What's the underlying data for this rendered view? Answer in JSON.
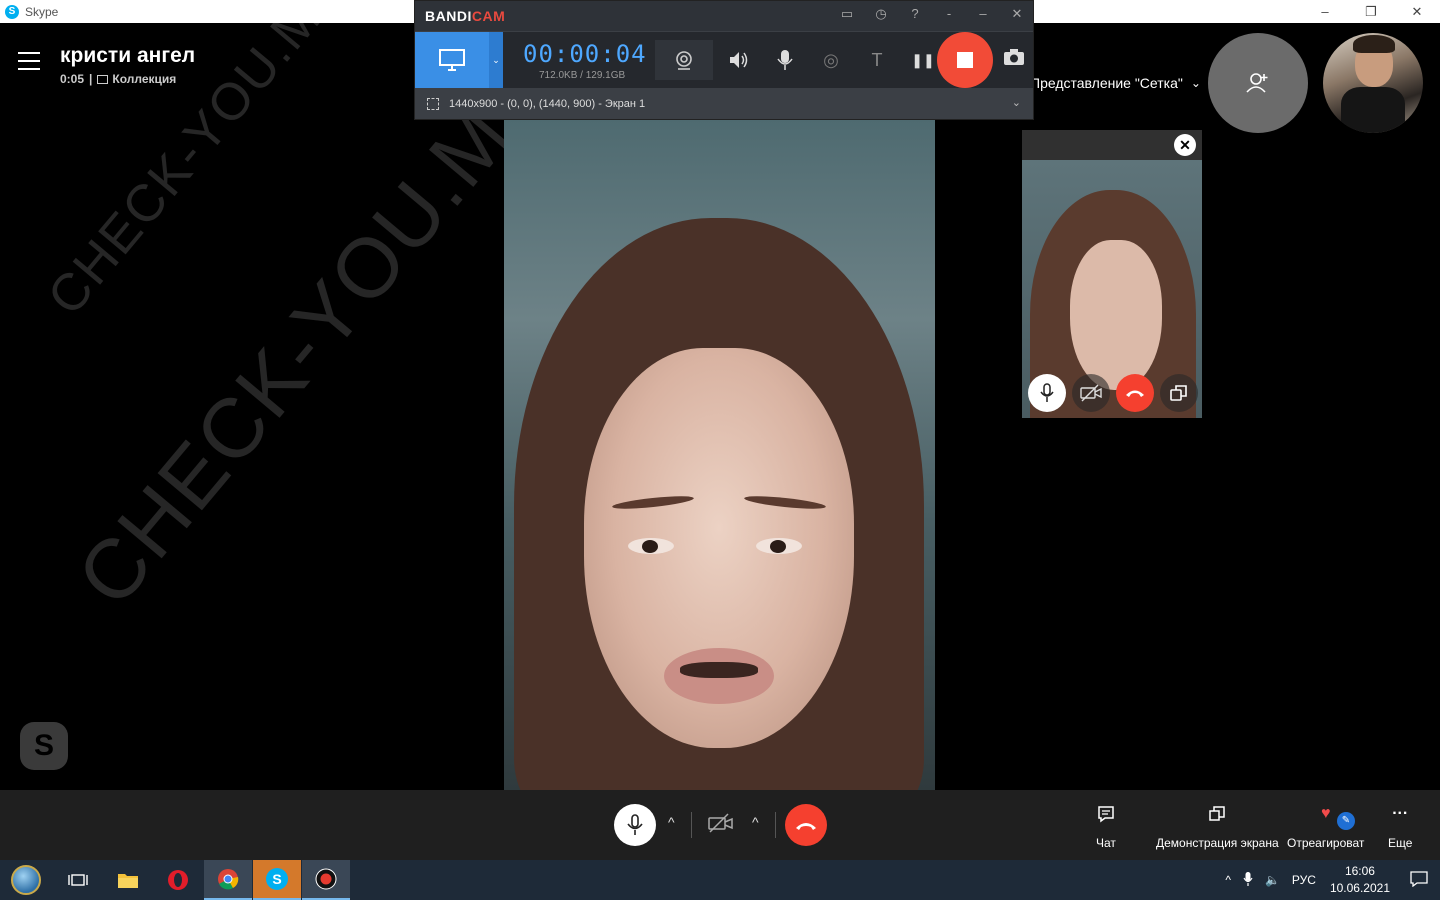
{
  "window": {
    "title": "Skype",
    "minimize": "–",
    "restore": "❐",
    "close": "✕"
  },
  "call": {
    "name": "кристи ангел",
    "duration": "0:05",
    "separator": "|",
    "collection_label": "Коллекция",
    "view_label": "Представление \"Сетка\"",
    "view_chevron": "⌄"
  },
  "watermark": {
    "text": "CHECK-YOU.ME"
  },
  "bandicam": {
    "logo_a": "BANDI",
    "logo_b": "CAM",
    "timer": "00:00:04",
    "size": "712.0KB / 129.1GB",
    "region": "1440x900 - (0, 0), (1440, 900) - Экран 1",
    "top_icons": [
      "folder-icon",
      "clock-icon",
      "help-icon",
      "mini-icon",
      "minimize-icon",
      "close-icon"
    ],
    "help_glyph": "?",
    "mini_glyph": "-",
    "minimize_glyph": "–",
    "close_glyph": "✕",
    "text_glyph": "T",
    "pause_glyph": "❚❚"
  },
  "self_preview": {
    "close_glyph": "✕"
  },
  "controls": {
    "chevron": "^",
    "chat_label": "Чат",
    "share_label": "Демонстрация экрана",
    "react_label": "Отреагироват",
    "more_label": "Еще",
    "more_glyph": "···",
    "pen_glyph": "✎"
  },
  "taskbar": {
    "lang": "РУС",
    "time": "16:06",
    "date": "10.06.2021",
    "tray_up": "^",
    "speaker_glyph": "🔈"
  },
  "colors": {
    "skype_blue": "#00aff0",
    "end_call_red": "#f5402f",
    "bandicam_blue": "#3a8fe6",
    "record_red": "#f24b37"
  }
}
